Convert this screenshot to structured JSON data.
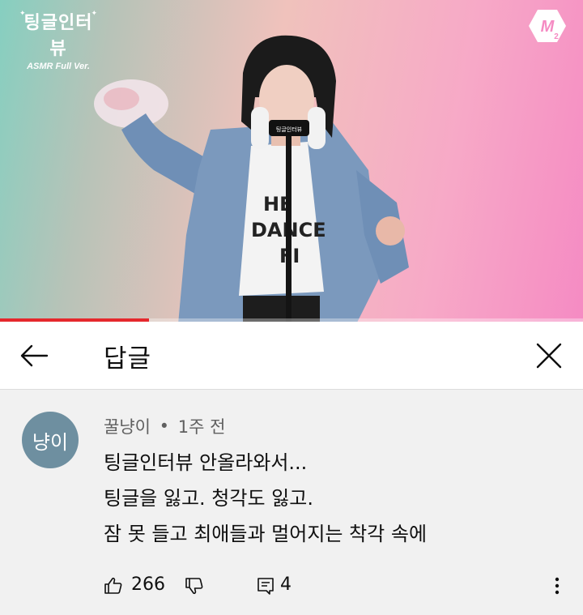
{
  "video": {
    "show_logo": "팅글인터뷰",
    "show_subtitle": "ASMR Full Ver.",
    "shirt_text": [
      "HE",
      "DANCE",
      "FI"
    ],
    "mic_label": "팅글인터뷰",
    "progress_fraction": 0.255,
    "accent_color": "#e5282d"
  },
  "header": {
    "title": "답글",
    "back_icon": "arrow-left-icon",
    "close_icon": "close-icon"
  },
  "comment": {
    "avatar_text": "냥이",
    "avatar_color": "#6e8fa0",
    "author": "꿀냥이",
    "separator": "•",
    "time": "1주 전",
    "lines": [
      "팅글인터뷰 안올라와서...",
      "팅글을 잃고. 청각도 잃고.",
      "잠 못 들고 최애들과 멀어지는 착각 속에"
    ],
    "like_count": "266",
    "reply_count": "4"
  }
}
